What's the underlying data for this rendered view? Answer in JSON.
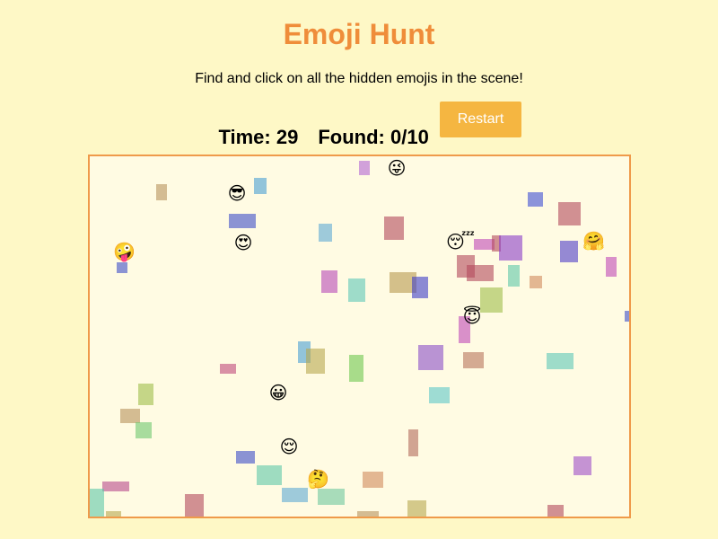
{
  "header": {
    "title": "Emoji Hunt",
    "instructions": "Find and click on all the hidden emojis in the scene!"
  },
  "stats": {
    "time_label": "Time:",
    "time_value": "29",
    "found_label": "Found:",
    "found_value": "0/10"
  },
  "controls": {
    "restart_label": "Restart"
  },
  "colors": {
    "background": "#fef8c6",
    "title": "#ef8d3a",
    "button": "#f5b641",
    "scene_border": "#ef9a4a",
    "scene_background": "#fffbe3"
  },
  "emojis": [
    {
      "name": "squinting-tongue-face",
      "char": "😜"
    },
    {
      "name": "sunglasses-face",
      "char": "😎"
    },
    {
      "name": "heart-eyes-face",
      "char": "😍"
    },
    {
      "name": "zany-face",
      "char": "🤪"
    },
    {
      "name": "sleeping-face",
      "char": "😴"
    },
    {
      "name": "hugging-face",
      "char": "🤗"
    },
    {
      "name": "halo-face",
      "char": "😇"
    },
    {
      "name": "grinning-face",
      "char": "😀"
    },
    {
      "name": "relieved-face",
      "char": "😌"
    },
    {
      "name": "thinking-face",
      "char": "🤔"
    }
  ]
}
